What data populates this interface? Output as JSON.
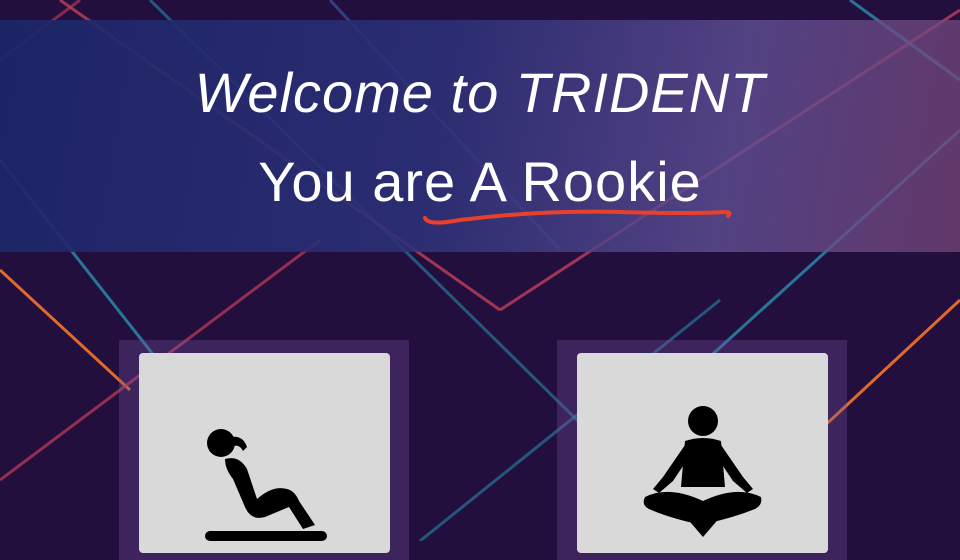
{
  "header": {
    "welcome_text": "Welcome to TRIDENT",
    "rank_text": "You are A Rookie"
  },
  "exercise_cards": [
    {
      "icon": "situp-icon"
    },
    {
      "icon": "meditation-icon"
    }
  ],
  "colors": {
    "background": "#230f3e",
    "banner": "#2a3275",
    "card": "#d9d9d9",
    "underline": "#e8402a",
    "line_orange": "#e06a2a",
    "line_teal": "#2a8fb0",
    "line_pink": "#c0405a"
  }
}
